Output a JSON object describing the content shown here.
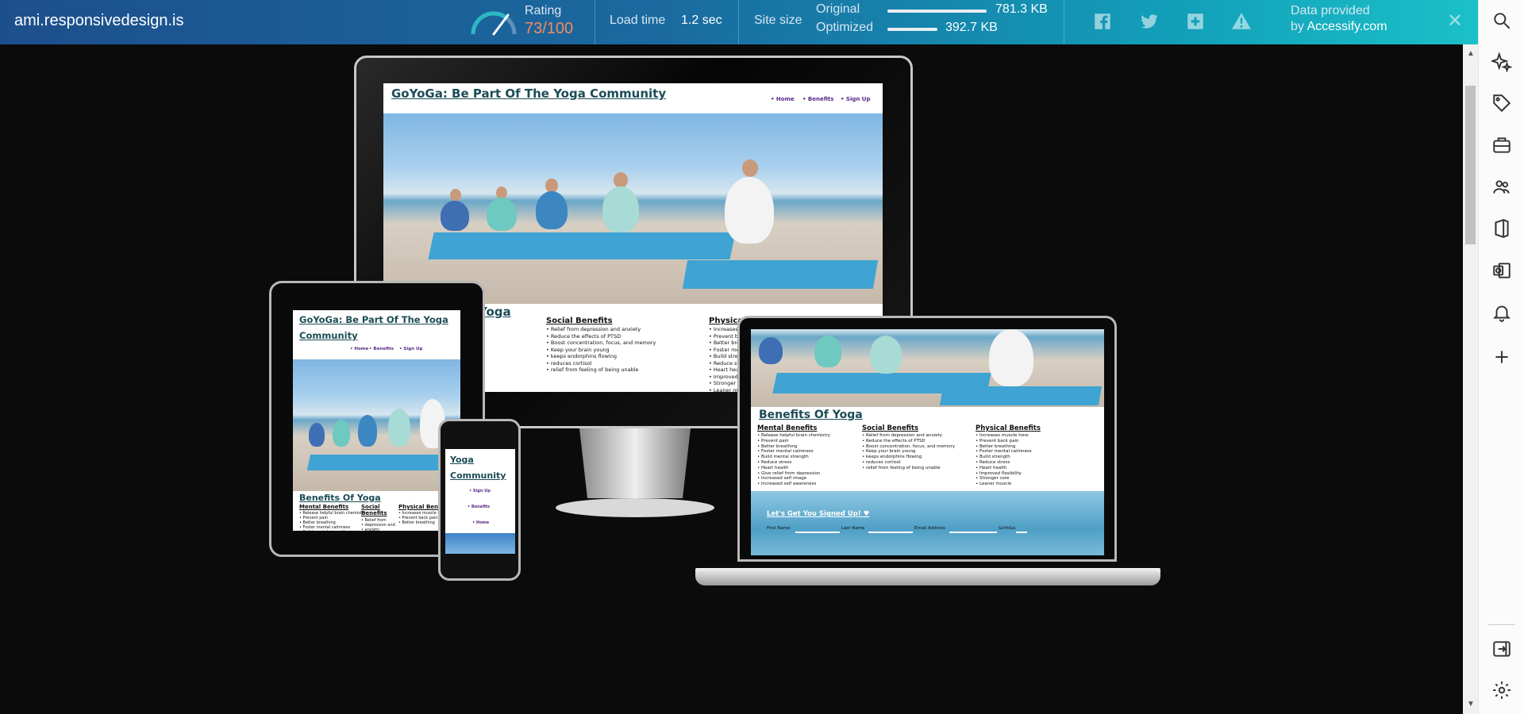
{
  "toolbar": {
    "site_url": "ami.responsivedesign.is",
    "rating_label": "Rating",
    "rating_value": "73/100",
    "rating_score": 73,
    "load_time_label": "Load time",
    "load_time_value": "1.2 sec",
    "site_size_label": "Site size",
    "original_label": "Original",
    "original_value": "781.3 KB",
    "optimized_label": "Optimized",
    "optimized_value": "392.7 KB",
    "optimized_fraction": 0.5,
    "share_icons": [
      "facebook-icon",
      "twitter-icon",
      "plus-square-icon",
      "warning-icon"
    ],
    "provided_line1": "Data provided",
    "provided_by": "by",
    "provided_name": "Accessify.com",
    "colors": {
      "rating": "#f58a5b",
      "gauge": "#2ab9c4"
    }
  },
  "right_sidebar": {
    "icons": [
      "search-icon",
      "sparkle-icon",
      "tag-icon",
      "toolbox-icon",
      "people-icon",
      "office-icon",
      "outlook-icon",
      "bell-icon",
      "plus-icon",
      "exit-panel-icon",
      "settings-icon"
    ]
  },
  "preview": {
    "site_title": "GoYoGa: Be Part Of The Yoga Community",
    "site_title_short_1": "Yoga",
    "site_title_short_2": "Community",
    "tablet_title_1": "GoYoGa: Be Part Of The Yoga",
    "tablet_title_2": "Community",
    "nav": [
      "• Home",
      "• Benefits",
      "• Sign Up"
    ],
    "phone_nav": [
      "• Sign Up",
      "• Benefits",
      "• Home"
    ],
    "benefits_heading": "Benefits Of Yoga",
    "benefits_heading_partial": "Yoga",
    "mental_heading": "Mental Benefits",
    "social_heading": "Social Benefits",
    "physical_heading": "Physical Benefits",
    "physical_heading_partial": "Physical",
    "tablet_social_1": "Social",
    "tablet_social_2": "Benefits",
    "tablet_physical": "Physical Benefi",
    "mental": [
      "Release helpful brain chemistry",
      "Prevent pain",
      "Better breathing",
      "Foster mental calmness",
      "Build mental strength",
      "Reduce stress",
      "Heart health",
      "Give relief from depression",
      "Increased self image",
      "Increased self awareness"
    ],
    "social": [
      "Relief from depression and anxiety",
      "Reduce the effects of PTSD",
      "Boost concentration, focus, and memory",
      "Keep your brain young",
      "keeps endorphins flowing",
      "reduces cortisol",
      "relief from feeling of being unable"
    ],
    "physical": [
      "Increases muscle tone",
      "Prevent back pain",
      "Better breathing",
      "Foster mental calmness",
      "Build strength",
      "Reduce stress",
      "Heart health",
      "Improved flexibility",
      "Stronger core",
      "Leaner muscle"
    ],
    "monitor_physical": [
      "Increases m",
      "Prevent bac",
      "Better brea",
      "Foster men",
      "Build stren",
      "Reduce str",
      "Heart healt",
      "Improved fl",
      "Stronger co",
      "Leaner mu"
    ],
    "tablet_mental": [
      "Release helpful brain chemistry",
      "Prevent pain",
      "Better breathing",
      "Foster mental calmness",
      "Build mental strength"
    ],
    "tablet_social": [
      "Relief from",
      "depression and",
      "anxiety"
    ],
    "tablet_physical_list": [
      "Increases muscle tone",
      "Prevent back pain",
      "Better breathing"
    ],
    "signup_title": "Let's Get You Signed Up! ♥",
    "field_first": "First Name",
    "field_last": "Last Name",
    "field_email": "Email Address",
    "field_goyoga": "GoYoGa"
  }
}
